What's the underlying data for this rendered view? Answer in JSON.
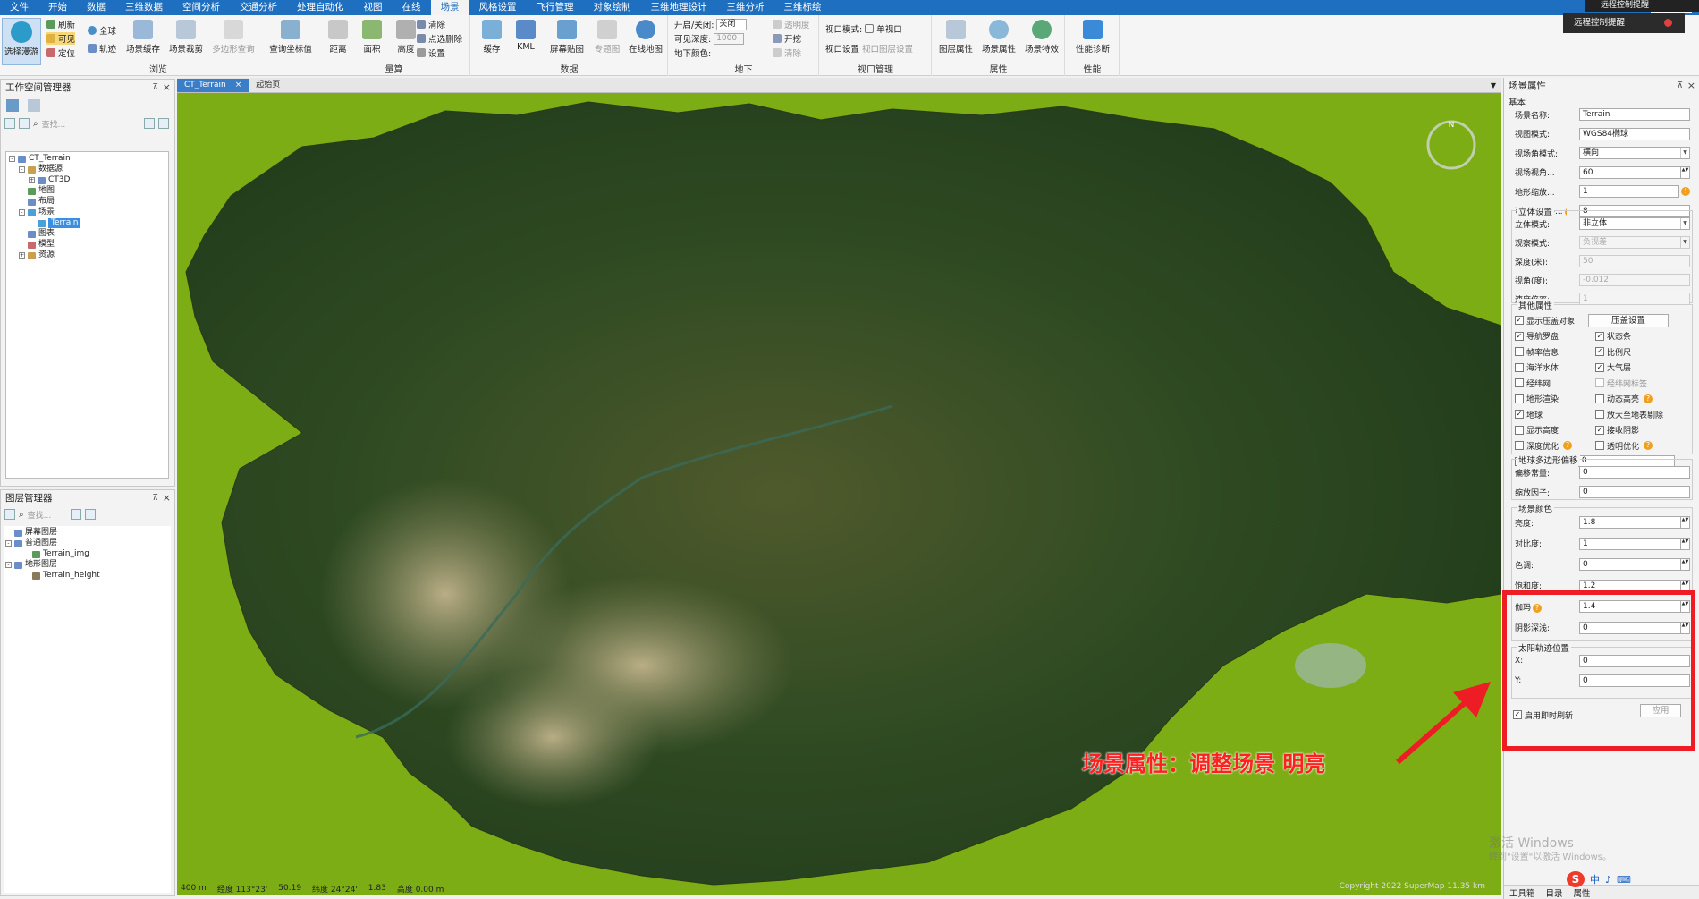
{
  "menubar": {
    "items": [
      "文件",
      "开始",
      "数据",
      "三维数据",
      "空间分析",
      "交通分析",
      "处理自动化",
      "视图",
      "在线",
      "场景",
      "风格设置",
      "飞行管理",
      "对象绘制",
      "三维地理设计",
      "三维分析",
      "三维标绘"
    ],
    "active_index": 9,
    "search_placeholder": "功能搜索",
    "remote_label": "远程控制提醒",
    "remote_tip": "远程控制提醒"
  },
  "ribbon": {
    "browse": {
      "label": "浏览",
      "select_roam": "选择漫游",
      "refresh": "刷新",
      "visible": "可见",
      "locate": "定位",
      "globe": "全球",
      "track": "轨迹",
      "scene_cache": "场景缓存",
      "scene_clip": "场景裁剪",
      "polygon_query": "多边形查询",
      "query_coord": "查询坐标值"
    },
    "measure": {
      "label": "量算",
      "distance": "距离",
      "area": "面积",
      "height": "高度",
      "clear": "清除",
      "point_delete": "点选删除",
      "settings": "设置"
    },
    "data": {
      "label": "数据",
      "cache": "缓存",
      "kml": "KML",
      "screen_overlay": "屏幕贴图",
      "thematic": "专题图",
      "online_map": "在线地图"
    },
    "underground": {
      "label": "地下",
      "open_close": "开启/关闭:",
      "open_close_val": "关闭",
      "visible_depth": "可见深度:",
      "visible_depth_val": "1000",
      "ground_color": "地下颜色:",
      "transparency": "透明度",
      "dig": "开挖",
      "clear": "清除"
    },
    "view": {
      "label": "视口管理",
      "view_mode": "视口模式:",
      "single_view": "单视口",
      "view_settings": "视口设置",
      "view_layer": "视口图层设置"
    },
    "props": {
      "label": "属性",
      "layer_props": "图层属性",
      "scene_props": "场景属性",
      "scene_effects": "场景特效"
    },
    "perf": {
      "label": "性能",
      "diagnosis": "性能诊断"
    }
  },
  "workspace": {
    "title": "工作空间管理器",
    "search_placeholder": "查找...",
    "tree": [
      {
        "label": "CT_Terrain",
        "level": 0,
        "exp": "-",
        "color": "#6a8fc8"
      },
      {
        "label": "数据源",
        "level": 1,
        "exp": "-",
        "color": "#c8a050"
      },
      {
        "label": "CT3D",
        "level": 2,
        "exp": "+",
        "color": "#6a8fc8"
      },
      {
        "label": "地图",
        "level": 1,
        "exp": "",
        "color": "#5a9a5a"
      },
      {
        "label": "布局",
        "level": 1,
        "exp": "",
        "color": "#6a8fc8"
      },
      {
        "label": "场景",
        "level": 1,
        "exp": "-",
        "color": "#4aa0d8"
      },
      {
        "label": "Terrain",
        "level": 2,
        "exp": "",
        "color": "#4aa0d8",
        "selected": true
      },
      {
        "label": "图表",
        "level": 1,
        "exp": "",
        "color": "#6a8fc8"
      },
      {
        "label": "模型",
        "level": 1,
        "exp": "",
        "color": "#c86a6a"
      },
      {
        "label": "资源",
        "level": 1,
        "exp": "+",
        "color": "#c8a050"
      }
    ]
  },
  "layers": {
    "title": "图层管理器",
    "search_placeholder": "查找...",
    "tree": [
      {
        "label": "屏幕图层",
        "level": 0,
        "exp": "",
        "color": "#6a8fc8"
      },
      {
        "label": "普通图层",
        "level": 0,
        "exp": "-",
        "color": "#6a8fc8"
      },
      {
        "label": "Terrain_img",
        "level": 1,
        "exp": "",
        "color": "#5a9a5a"
      },
      {
        "label": "地形图层",
        "level": 0,
        "exp": "-",
        "color": "#6a8fc8"
      },
      {
        "label": "Terrain_height",
        "level": 1,
        "exp": "",
        "color": "#8a7a5a"
      }
    ]
  },
  "view_tabs": {
    "active": "CT_Terrain",
    "other": "起始页"
  },
  "status": {
    "scale": "400 m",
    "lon": "经度 113°23'",
    "lon2": "50.19",
    "lat": "纬度 24°24'",
    "lat2": "1.83",
    "alt": "高度 0.00 m"
  },
  "copyright": "Copyright 2022 SuperMap  11.35 km",
  "annotation": "场景属性：调整场景 明亮",
  "scene_props": {
    "title": "场景属性",
    "basic": "基本",
    "rows_basic": [
      {
        "label": "场景名称:",
        "value": "Terrain"
      },
      {
        "label": "视图模式:",
        "value": "WGS84椭球"
      },
      {
        "label": "视场角模式:",
        "value": "横向",
        "dd": true
      },
      {
        "label": "视场视角...",
        "value": "60",
        "spin": true
      },
      {
        "label": "地形缩放...",
        "value": "1",
        "warn": true
      },
      {
        "label": "可选择图层...",
        "value": "8",
        "q": true
      }
    ],
    "stereo_title": "立体设置",
    "rows_stereo": [
      {
        "label": "立体模式:",
        "value": "非立体",
        "dd": true
      },
      {
        "label": "观察模式:",
        "value": "负视差",
        "dd": true,
        "dim": true
      },
      {
        "label": "深度(米):",
        "value": "50",
        "dim": true
      },
      {
        "label": "视角(度):",
        "value": "-0.012",
        "dim": true
      },
      {
        "label": "速度倍率:",
        "value": "1",
        "dim": true
      }
    ],
    "other_title": "其他属性",
    "pressure_btn": "压盖设置",
    "checks": [
      {
        "label": "显示压盖对象",
        "checked": true,
        "col": 0
      },
      {
        "label": "导航罗盘",
        "checked": true,
        "col": 0
      },
      {
        "label": "状态条",
        "checked": true,
        "col": 1
      },
      {
        "label": "帧率信息",
        "checked": false,
        "col": 0
      },
      {
        "label": "比例尺",
        "checked": true,
        "col": 1
      },
      {
        "label": "海洋水体",
        "checked": false,
        "col": 0
      },
      {
        "label": "大气层",
        "checked": true,
        "col": 1
      },
      {
        "label": "经纬网",
        "checked": false,
        "col": 0
      },
      {
        "label": "经纬网标签",
        "checked": false,
        "col": 1,
        "dim": true
      },
      {
        "label": "地形渲染",
        "checked": false,
        "col": 0
      },
      {
        "label": "动态高亮",
        "checked": false,
        "col": 1,
        "q": true
      },
      {
        "label": "地球",
        "checked": true,
        "col": 0
      },
      {
        "label": "放大至地表剔除",
        "checked": false,
        "col": 1
      },
      {
        "label": "显示高度",
        "checked": false,
        "col": 0
      },
      {
        "label": "接收阴影",
        "checked": true,
        "col": 1
      },
      {
        "label": "深度优化",
        "checked": false,
        "col": 0,
        "q": true
      },
      {
        "label": "透明优化",
        "checked": false,
        "col": 1,
        "q": true
      },
      {
        "label": "TIN地形精边",
        "checked": true,
        "col": 0,
        "val": "0"
      }
    ],
    "offset_title": "地球多边形偏移",
    "rows_offset": [
      {
        "label": "偏移常量:",
        "value": "0"
      },
      {
        "label": "缩放因子:",
        "value": "0"
      }
    ],
    "color_title": "场景颜色",
    "rows_color": [
      {
        "label": "亮度:",
        "value": "1.8"
      },
      {
        "label": "对比度:",
        "value": "1"
      },
      {
        "label": "色调:",
        "value": "0"
      },
      {
        "label": "饱和度:",
        "value": "1.2"
      },
      {
        "label": "伽玛",
        "value": "1.4",
        "q": true
      },
      {
        "label": "阴影深浅:",
        "value": "0"
      }
    ],
    "sun_title": "太阳轨迹位置",
    "rows_sun": [
      {
        "label": "X:",
        "value": "0"
      },
      {
        "label": "Y:",
        "value": "0"
      }
    ],
    "realtime": "启用即时刷新",
    "apply": "应用",
    "bottom_tabs": [
      "工具箱",
      "目录",
      "属性"
    ]
  },
  "watermark": {
    "line1": "激活 Windows",
    "line2": "转到\"设置\"以激活 Windows。"
  },
  "tray": {
    "ime": "中",
    "logo": "S"
  }
}
